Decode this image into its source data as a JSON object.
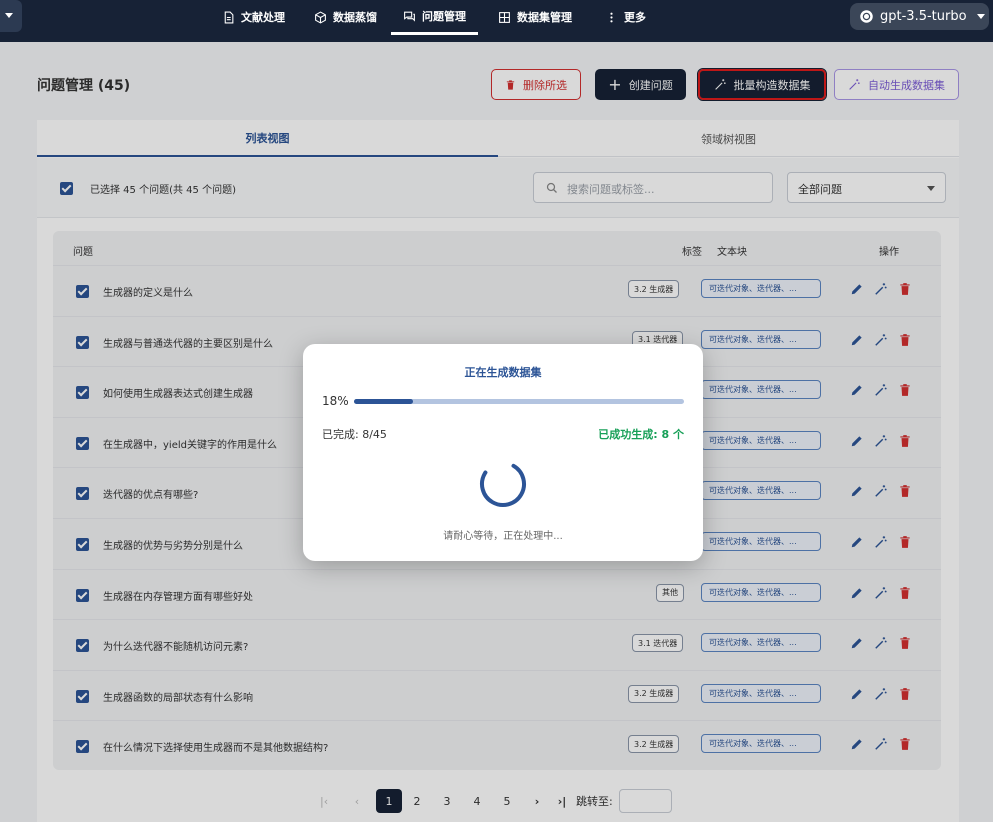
{
  "nav": {
    "items": [
      {
        "label": "文献处理",
        "icon": "document-icon"
      },
      {
        "label": "数据蒸馏",
        "icon": "cube-icon"
      },
      {
        "label": "问题管理",
        "icon": "chat-icon",
        "active": true
      },
      {
        "label": "数据集管理",
        "icon": "grid-icon"
      },
      {
        "label": "更多",
        "icon": "more-vertical-icon"
      }
    ],
    "model": "gpt-3.5-turbo"
  },
  "header": {
    "title": "问题管理 (45)",
    "buttons": {
      "delete": "删除所选",
      "create": "创建问题",
      "batch": "批量构造数据集",
      "auto": "自动生成数据集"
    }
  },
  "tabs": [
    "列表视图",
    "领域树视图"
  ],
  "toolbar": {
    "selection": "已选择 45 个问题(共 45 个问题)",
    "search_placeholder": "搜索问题或标签...",
    "filter": "全部问题"
  },
  "table": {
    "headers": {
      "question": "问题",
      "tag": "标签",
      "chunk": "文本块",
      "actions": "操作"
    },
    "rows": [
      {
        "question": "生成器的定义是什么",
        "tag": "3.2 生成器",
        "chunk": "可迭代对象、迭代器、..."
      },
      {
        "question": "生成器与普通迭代器的主要区别是什么",
        "tag": "3.1 迭代器",
        "chunk": "可迭代对象、迭代器、..."
      },
      {
        "question": "如何使用生成器表达式创建生成器",
        "tag": "",
        "chunk": "可迭代对象、迭代器、..."
      },
      {
        "question": "在生成器中，yield关键字的作用是什么",
        "tag": "",
        "chunk": "可迭代对象、迭代器、..."
      },
      {
        "question": "迭代器的优点有哪些?",
        "tag": "",
        "chunk": "可迭代对象、迭代器、..."
      },
      {
        "question": "生成器的优势与劣势分别是什么",
        "tag": "",
        "chunk": "可迭代对象、迭代器、..."
      },
      {
        "question": "生成器在内存管理方面有哪些好处",
        "tag": "其他",
        "chunk": "可迭代对象、迭代器、..."
      },
      {
        "question": "为什么迭代器不能随机访问元素?",
        "tag": "3.1 迭代器",
        "chunk": "可迭代对象、迭代器、..."
      },
      {
        "question": "生成器函数的局部状态有什么影响",
        "tag": "3.2 生成器",
        "chunk": "可迭代对象、迭代器、..."
      },
      {
        "question": "在什么情况下选择使用生成器而不是其他数据结构?",
        "tag": "3.2 生成器",
        "chunk": "可迭代对象、迭代器、..."
      }
    ]
  },
  "modal": {
    "title": "正在生成数据集",
    "percent_label": "18%",
    "progress": 0.18,
    "completed": "已完成: 8/45",
    "success": "已成功生成: 8 个",
    "wait": "请耐心等待，正在处理中..."
  },
  "pagination": {
    "pages": [
      "1",
      "2",
      "3",
      "4",
      "5"
    ],
    "current": "1",
    "jump_label": "跳转至:"
  },
  "colors": {
    "navbar": "#172236",
    "primary": "#2c5496",
    "danger": "#d32f2f",
    "success": "#18a058",
    "auto": "#7c5cd6"
  }
}
